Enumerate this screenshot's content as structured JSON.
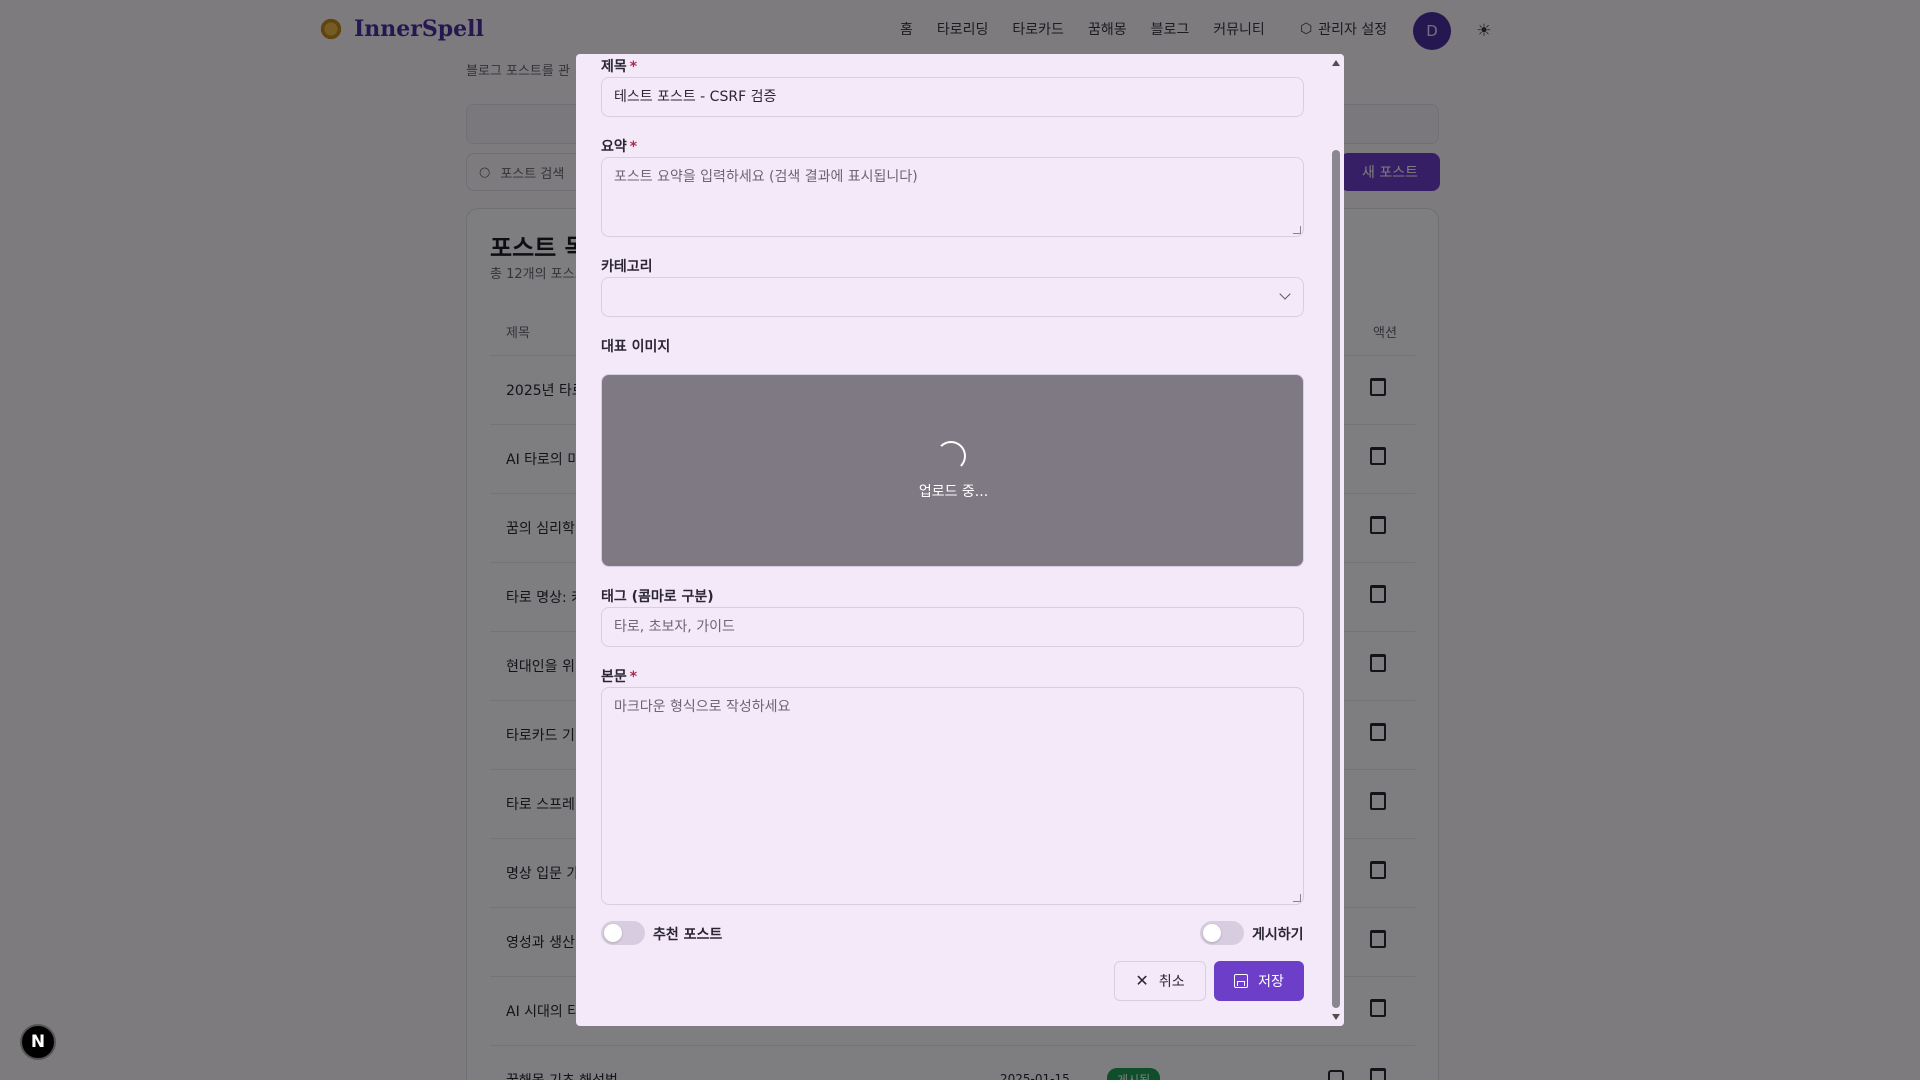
{
  "nav": {
    "logo_text": "InnerSpell",
    "links": [
      "홈",
      "타로리딩",
      "타로카드",
      "꿈해몽",
      "블로그",
      "커뮤니티"
    ],
    "admin_label": "관리자 설정",
    "avatar_initial": "D"
  },
  "background": {
    "subtitle": "블로그 포스트를 관",
    "search_placeholder": "포스트 검색",
    "new_post_label": "새 포스트",
    "card_title": "포스트 목",
    "card_subtitle": "총 12개의 포스트",
    "col_title": "제목",
    "col_action": "액션",
    "rows": [
      "2025년 타로",
      "AI 타로의 미",
      "꿈의 심리학",
      "타로 명상: 카",
      "현대인을 위",
      "타로카드 기",
      "타로 스프레",
      "명상 입문 가",
      "영성과 생산",
      "AI 시대의 타",
      "꿈해몽 기초 해석법"
    ],
    "last_row_date": "2025-01-15",
    "last_row_badge": "게시됨"
  },
  "modal": {
    "title_label": "제목",
    "title_value": "테스트 포스트 - CSRF 검증",
    "summary_label": "요약",
    "summary_placeholder": "포스트 요약을 입력하세요 (검색 결과에 표시됩니다)",
    "category_label": "카테고리",
    "category_value": "",
    "image_label": "대표 이미지",
    "upload_status": "업로드 중...",
    "tags_label": "태그 (콤마로 구분)",
    "tags_placeholder": "타로, 초보자, 가이드",
    "body_label": "본문",
    "body_placeholder": "마크다운 형식으로 작성하세요",
    "featured_label": "추천 포스트",
    "featured_on": false,
    "publish_label": "게시하기",
    "publish_on": false,
    "cancel_label": "취소",
    "save_label": "저장",
    "required_mark": "*"
  },
  "dev_badge": "N",
  "colors": {
    "accent": "#6d3fc9",
    "modal_bg": "#f4e9f9",
    "upload_bg": "#7e7982"
  }
}
